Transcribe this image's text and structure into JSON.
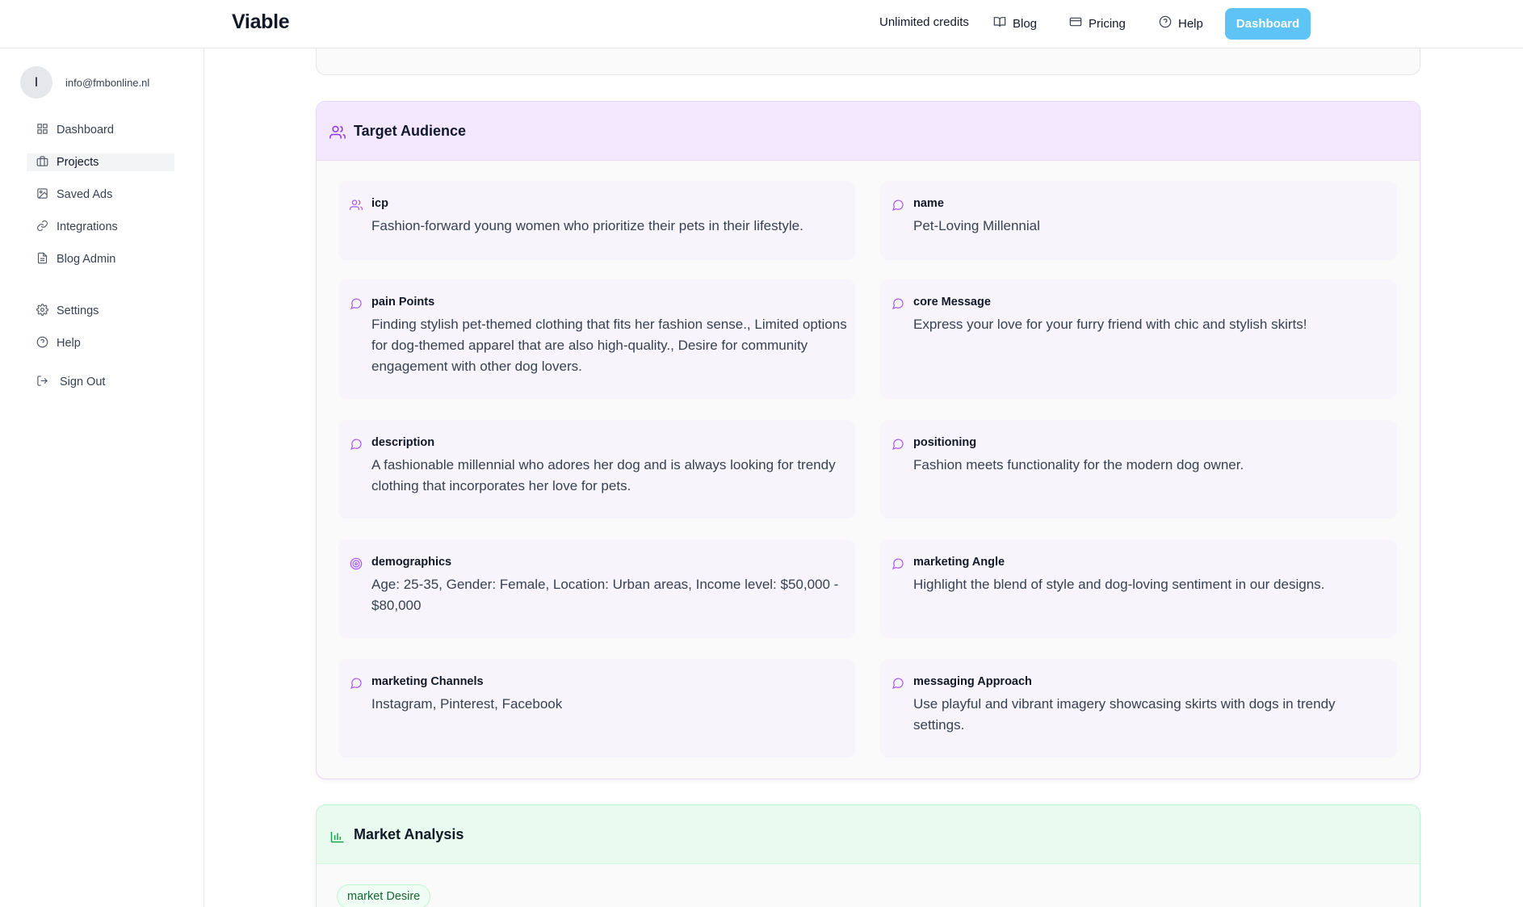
{
  "header": {
    "brand": "Viable",
    "credits": "Unlimited credits",
    "blog": "Blog",
    "pricing": "Pricing",
    "help": "Help",
    "dashboard_button": "Dashboard"
  },
  "sidebar": {
    "avatar_initial": "I",
    "email": "info@fmbonline.nl",
    "items": [
      {
        "label": "Dashboard",
        "icon": "grid-icon"
      },
      {
        "label": "Projects",
        "icon": "briefcase-icon",
        "active": true
      },
      {
        "label": "Saved Ads",
        "icon": "image-icon"
      },
      {
        "label": "Integrations",
        "icon": "link-icon"
      },
      {
        "label": "Blog Admin",
        "icon": "file-text-icon"
      },
      {
        "label": "Settings",
        "icon": "gear-icon"
      },
      {
        "label": "Help",
        "icon": "help-circle-icon"
      },
      {
        "label": "Sign Out",
        "icon": "log-out-icon"
      }
    ]
  },
  "target_audience": {
    "title": "Target Audience",
    "fields": [
      {
        "label": "icp",
        "value": "Fashion-forward young women who prioritize their pets in their lifestyle.",
        "icon": "users-icon"
      },
      {
        "label": "name",
        "value": "Pet-Loving Millennial",
        "icon": "message-circle-icon"
      },
      {
        "label": "pain Points",
        "value": "Finding stylish pet-themed clothing that fits her fashion sense., Limited options for dog-themed apparel that are also high-quality., Desire for community engagement with other dog lovers.",
        "icon": "message-circle-icon"
      },
      {
        "label": "core Message",
        "value": "Express your love for your furry friend with chic and stylish skirts!",
        "icon": "message-circle-icon"
      },
      {
        "label": "description",
        "value": "A fashionable millennial who adores her dog and is always looking for trendy clothing that incorporates her love for pets.",
        "icon": "message-circle-icon"
      },
      {
        "label": "positioning",
        "value": "Fashion meets functionality for the modern dog owner.",
        "icon": "message-circle-icon"
      },
      {
        "label": "demographics",
        "value": "Age: 25-35, Gender: Female, Location: Urban areas, Income level: $50,000 - $80,000",
        "icon": "target-icon"
      },
      {
        "label": "marketing Angle",
        "value": "Highlight the blend of style and dog-loving sentiment in our designs.",
        "icon": "message-circle-icon"
      },
      {
        "label": "marketing Channels",
        "value": "Instagram, Pinterest, Facebook",
        "icon": "message-circle-icon"
      },
      {
        "label": "messaging Approach",
        "value": "Use playful and vibrant imagery showcasing skirts with dogs in trendy settings.",
        "icon": "message-circle-icon"
      }
    ]
  },
  "market_analysis": {
    "title": "Market Analysis",
    "pill": "market Desire"
  },
  "colors": {
    "accent": "#5ec4f5",
    "purple": "#a855f7",
    "green": "#16a34a"
  }
}
